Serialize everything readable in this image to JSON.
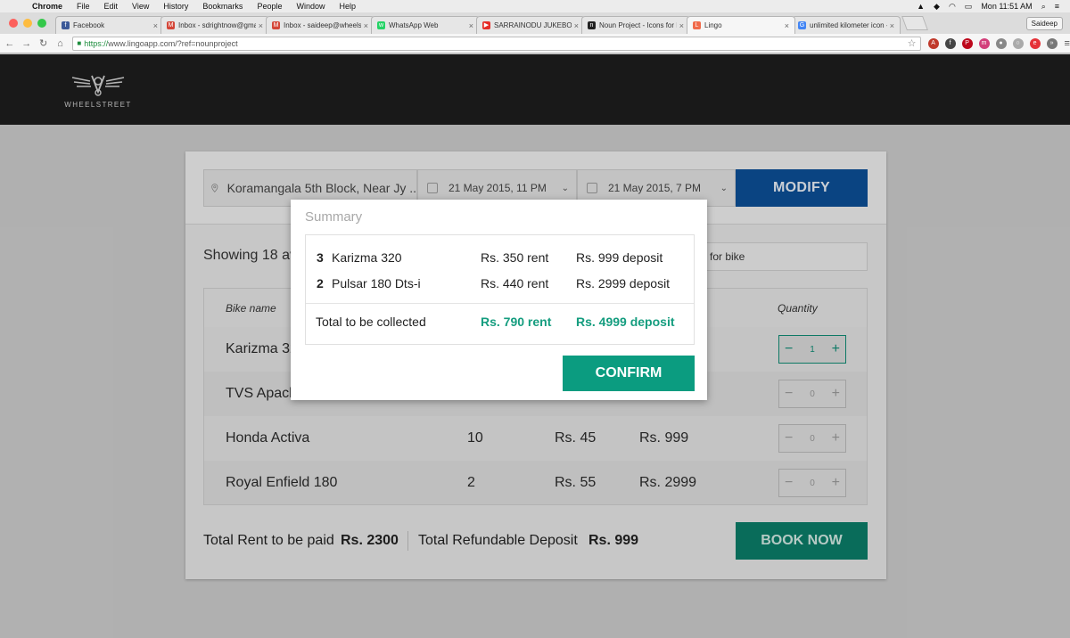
{
  "menubar": {
    "app": "Chrome",
    "items": [
      "File",
      "Edit",
      "View",
      "History",
      "Bookmarks",
      "People",
      "Window",
      "Help"
    ],
    "clock": "Mon 11:51 AM"
  },
  "tabs": [
    {
      "label": "Facebook",
      "color": "#3b5998",
      "glyph": "f"
    },
    {
      "label": "Inbox - sdrightnow@gmail",
      "color": "#d44638",
      "glyph": "M"
    },
    {
      "label": "Inbox - saideep@wheelstr",
      "color": "#d44638",
      "glyph": "M"
    },
    {
      "label": "WhatsApp Web",
      "color": "#25d366",
      "glyph": "w"
    },
    {
      "label": "SARRAINODU JUKEBOX",
      "color": "#e52d27",
      "glyph": "▶"
    },
    {
      "label": "Noun Project - Icons for Ev",
      "color": "#222222",
      "glyph": "n"
    },
    {
      "label": "Lingo",
      "color": "#f06a4a",
      "glyph": "L"
    },
    {
      "label": "unlimited kilometer icon - G",
      "color": "#4285f4",
      "glyph": "G"
    }
  ],
  "profile": "Saideep",
  "address": {
    "scheme": "https://",
    "rest": "www.lingoapp.com/?ref=nounproject"
  },
  "site": {
    "logo_text": "WHEELSTREET"
  },
  "search": {
    "location": "Koramangala 5th Block, Near Jy ..",
    "start_date": "21 May 2015, 11 PM",
    "end_date": "21 May 2015, 7 PM",
    "modify_label": "MODIFY"
  },
  "listing": {
    "showing_text": "Showing 18 av",
    "filter_text": "for bike",
    "headers": {
      "name": "Bike name",
      "quantity": "Quantity"
    },
    "rows": [
      {
        "name": "Karizma 32",
        "available": "",
        "rent": "",
        "deposit": "",
        "qty": "1"
      },
      {
        "name": "TVS Apach",
        "available": "",
        "rent": "",
        "deposit": "",
        "qty": "0"
      },
      {
        "name": "Honda Activa",
        "available": "10",
        "rent": "Rs. 45",
        "deposit": "Rs. 999",
        "qty": "0"
      },
      {
        "name": "Royal Enfield 180",
        "available": "2",
        "rent": "Rs. 55",
        "deposit": "Rs. 2999",
        "qty": "0"
      }
    ]
  },
  "footer": {
    "rent_label": "Total Rent to be paid",
    "rent_value": "Rs. 2300",
    "deposit_label": "Total Refundable Deposit",
    "deposit_value": "Rs. 999",
    "book_label": "BOOK NOW"
  },
  "modal": {
    "title": "Summary",
    "items": [
      {
        "qty": "3",
        "name": "Karizma 320",
        "rent": "Rs. 350 rent",
        "deposit": "Rs. 999 deposit"
      },
      {
        "qty": "2",
        "name": "Pulsar 180 Dts-i",
        "rent": "Rs. 440 rent",
        "deposit": "Rs. 2999 deposit"
      }
    ],
    "total_label": "Total to be collected",
    "total_rent": "Rs. 790 rent",
    "total_deposit": "Rs. 4999 deposit",
    "confirm_label": "CONFIRM"
  },
  "colors": {
    "modify": "#0c4e94",
    "book_now": "#0b7b67",
    "confirm": "#0b9c80",
    "accent_green": "#159d7f"
  }
}
